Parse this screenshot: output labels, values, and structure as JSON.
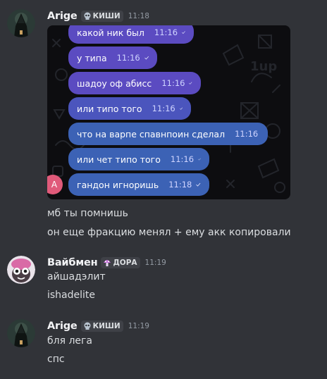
{
  "colors": {
    "background": "#313338",
    "username": "#f2f3f5",
    "timestamp": "#949ba4",
    "message_text": "#dbdee1",
    "bubble_violet": "#5b4bc1",
    "bubble_blue": "#3c62b5"
  },
  "groups": [
    {
      "username": "Arige",
      "tag": "КИШИ",
      "tag_icon": "skull-icon",
      "time": "11:18",
      "image": {
        "bubbles": [
          {
            "text": "какой ник был",
            "time": "11:16"
          },
          {
            "text": "у типа",
            "time": "11:16"
          },
          {
            "text": "шадоу оф абисс",
            "time": "11:16"
          },
          {
            "text": "или типо того",
            "time": "11:16"
          },
          {
            "text": "что на варпе спавнпоин сделал",
            "time": "11:16"
          },
          {
            "text": "или чет типо того",
            "time": "11:16"
          },
          {
            "text": "гандон игноришь",
            "time": "11:18"
          }
        ],
        "avatar_letter": "A"
      },
      "messages": [
        "мб ты помнишь",
        "он еще фракцию менял + ему акк копировали"
      ]
    },
    {
      "username": "Вайбмен",
      "tag": "ДОРА",
      "tag_icon": "mushroom-icon",
      "time": "11:19",
      "messages": [
        "айшадэлит",
        "ishadelite"
      ]
    },
    {
      "username": "Arige",
      "tag": "КИШИ",
      "tag_icon": "skull-icon",
      "time": "11:19",
      "messages": [
        "бля лега",
        "спс"
      ]
    }
  ]
}
